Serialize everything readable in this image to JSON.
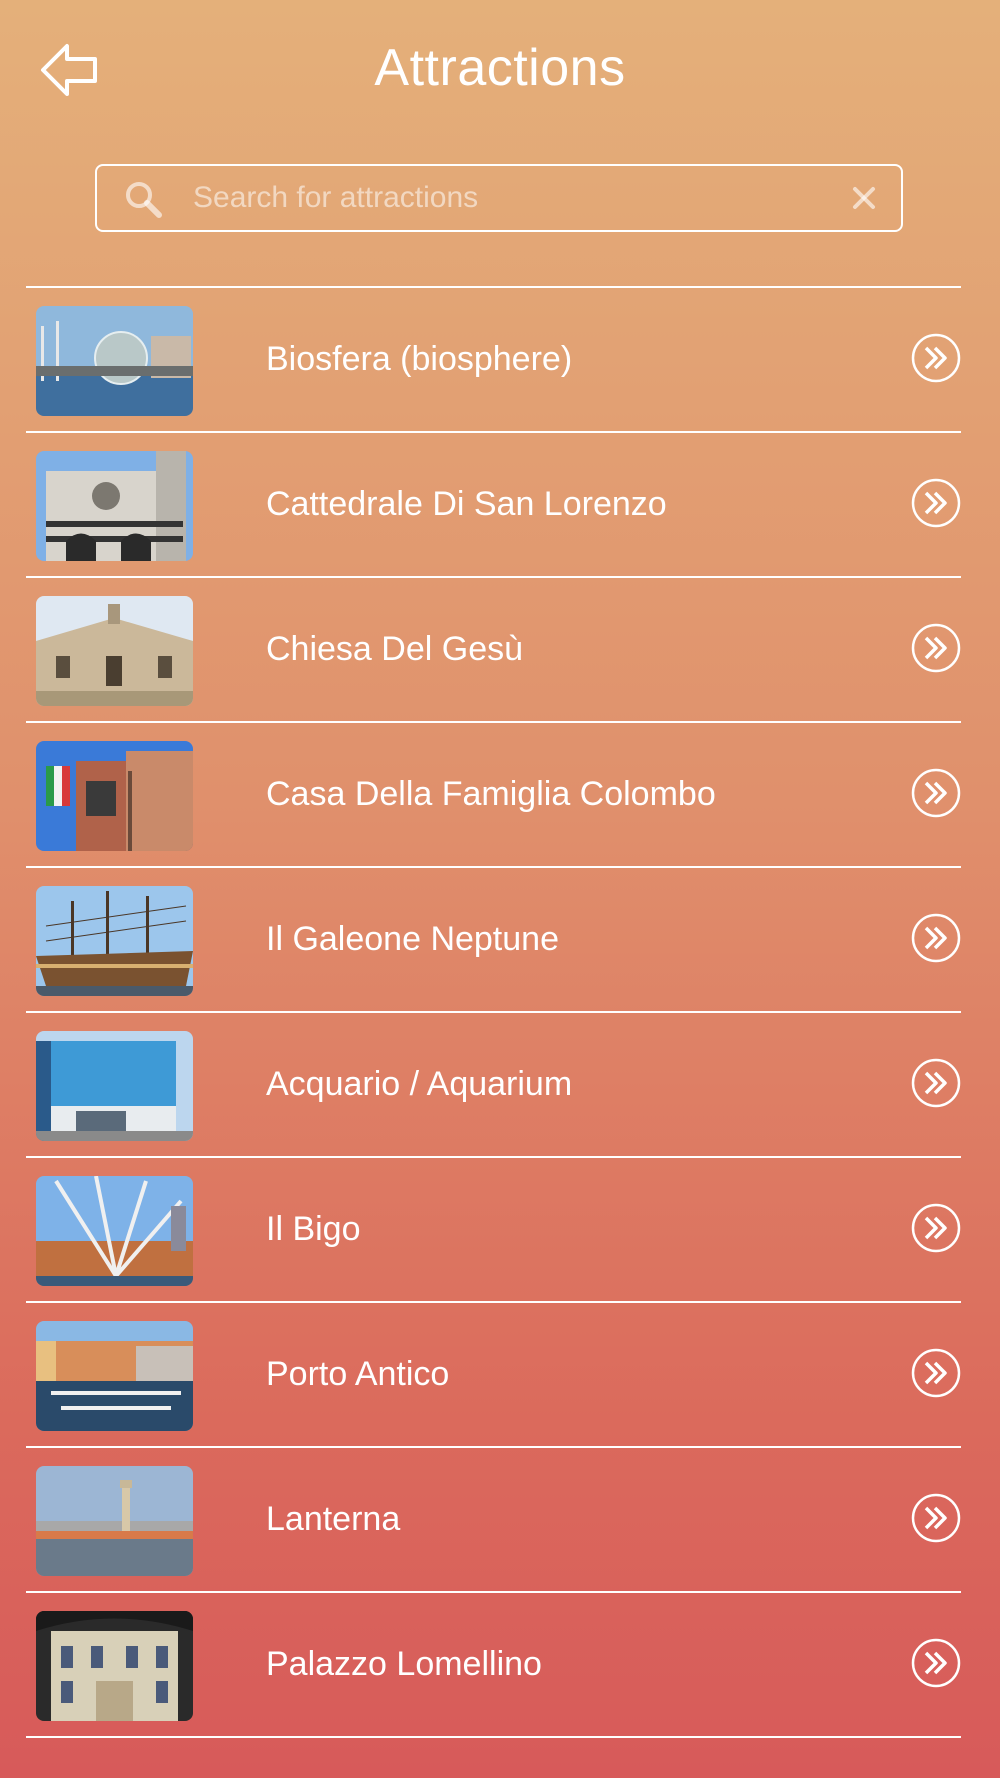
{
  "header": {
    "title": "Attractions",
    "back_icon": "back-arrow-icon"
  },
  "search": {
    "placeholder": "Search for attractions",
    "value": "",
    "search_icon": "search-icon",
    "clear_icon": "close-icon"
  },
  "colors": {
    "background_top": "#e4b07a",
    "background_bottom": "#d75a5a",
    "foreground": "#ffffff"
  },
  "attractions": [
    {
      "label": "Biosfera (biosphere)",
      "icon": "chevron-double-right-icon"
    },
    {
      "label": "Cattedrale Di San Lorenzo",
      "icon": "chevron-double-right-icon"
    },
    {
      "label": "Chiesa Del Gesù",
      "icon": "chevron-double-right-icon"
    },
    {
      "label": "Casa Della Famiglia Colombo",
      "icon": "chevron-double-right-icon"
    },
    {
      "label": "Il Galeone Neptune",
      "icon": "chevron-double-right-icon"
    },
    {
      "label": "Acquario / Aquarium",
      "icon": "chevron-double-right-icon"
    },
    {
      "label": "Il Bigo",
      "icon": "chevron-double-right-icon"
    },
    {
      "label": "Porto Antico",
      "icon": "chevron-double-right-icon"
    },
    {
      "label": "Lanterna",
      "icon": "chevron-double-right-icon"
    },
    {
      "label": "Palazzo Lomellino",
      "icon": "chevron-double-right-icon"
    }
  ]
}
